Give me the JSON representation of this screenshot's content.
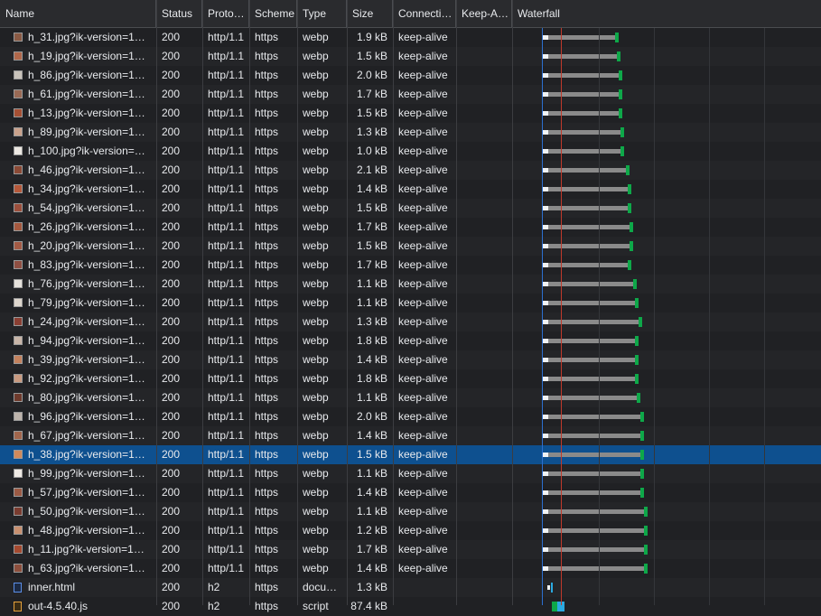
{
  "columns": [
    "Name",
    "Status",
    "Proto…",
    "Scheme",
    "Type",
    "Size",
    "Connecti…",
    "Keep-A…",
    "Waterfall"
  ],
  "rows": [
    {
      "name": "h_31.jpg?ik-version=1…",
      "status": "200",
      "proto": "http/1.1",
      "scheme": "https",
      "type": "webp",
      "size": "1.9 kB",
      "conn": "keep-alive",
      "thumb": "#8a5a44"
    },
    {
      "name": "h_19.jpg?ik-version=1…",
      "status": "200",
      "proto": "http/1.1",
      "scheme": "https",
      "type": "webp",
      "size": "1.5 kB",
      "conn": "keep-alive",
      "thumb": "#b0674a"
    },
    {
      "name": "h_86.jpg?ik-version=1…",
      "status": "200",
      "proto": "http/1.1",
      "scheme": "https",
      "type": "webp",
      "size": "2.0 kB",
      "conn": "keep-alive",
      "thumb": "#c9c3bb"
    },
    {
      "name": "h_61.jpg?ik-version=1…",
      "status": "200",
      "proto": "http/1.1",
      "scheme": "https",
      "type": "webp",
      "size": "1.7 kB",
      "conn": "keep-alive",
      "thumb": "#9a6a55"
    },
    {
      "name": "h_13.jpg?ik-version=1…",
      "status": "200",
      "proto": "http/1.1",
      "scheme": "https",
      "type": "webp",
      "size": "1.5 kB",
      "conn": "keep-alive",
      "thumb": "#a65034"
    },
    {
      "name": "h_89.jpg?ik-version=1…",
      "status": "200",
      "proto": "http/1.1",
      "scheme": "https",
      "type": "webp",
      "size": "1.3 kB",
      "conn": "keep-alive",
      "thumb": "#caa28c"
    },
    {
      "name": "h_100.jpg?ik-version=…",
      "status": "200",
      "proto": "http/1.1",
      "scheme": "https",
      "type": "webp",
      "size": "1.0 kB",
      "conn": "keep-alive",
      "thumb": "#ece8e2"
    },
    {
      "name": "h_46.jpg?ik-version=1…",
      "status": "200",
      "proto": "http/1.1",
      "scheme": "https",
      "type": "webp",
      "size": "2.1 kB",
      "conn": "keep-alive",
      "thumb": "#8b4a36"
    },
    {
      "name": "h_34.jpg?ik-version=1…",
      "status": "200",
      "proto": "http/1.1",
      "scheme": "https",
      "type": "webp",
      "size": "1.4 kB",
      "conn": "keep-alive",
      "thumb": "#b5583a"
    },
    {
      "name": "h_54.jpg?ik-version=1…",
      "status": "200",
      "proto": "http/1.1",
      "scheme": "https",
      "type": "webp",
      "size": "1.5 kB",
      "conn": "keep-alive",
      "thumb": "#9c4f3c"
    },
    {
      "name": "h_26.jpg?ik-version=1…",
      "status": "200",
      "proto": "http/1.1",
      "scheme": "https",
      "type": "webp",
      "size": "1.7 kB",
      "conn": "keep-alive",
      "thumb": "#a4583e"
    },
    {
      "name": "h_20.jpg?ik-version=1…",
      "status": "200",
      "proto": "http/1.1",
      "scheme": "https",
      "type": "webp",
      "size": "1.5 kB",
      "conn": "keep-alive",
      "thumb": "#a35a44"
    },
    {
      "name": "h_83.jpg?ik-version=1…",
      "status": "200",
      "proto": "http/1.1",
      "scheme": "https",
      "type": "webp",
      "size": "1.7 kB",
      "conn": "keep-alive",
      "thumb": "#8f4f42"
    },
    {
      "name": "h_76.jpg?ik-version=1…",
      "status": "200",
      "proto": "http/1.1",
      "scheme": "https",
      "type": "webp",
      "size": "1.1 kB",
      "conn": "keep-alive",
      "thumb": "#e6e2dc"
    },
    {
      "name": "h_79.jpg?ik-version=1…",
      "status": "200",
      "proto": "http/1.1",
      "scheme": "https",
      "type": "webp",
      "size": "1.1 kB",
      "conn": "keep-alive",
      "thumb": "#ddd6cd"
    },
    {
      "name": "h_24.jpg?ik-version=1…",
      "status": "200",
      "proto": "http/1.1",
      "scheme": "https",
      "type": "webp",
      "size": "1.3 kB",
      "conn": "keep-alive",
      "thumb": "#8a3f33"
    },
    {
      "name": "h_94.jpg?ik-version=1…",
      "status": "200",
      "proto": "http/1.1",
      "scheme": "https",
      "type": "webp",
      "size": "1.8 kB",
      "conn": "keep-alive",
      "thumb": "#c8b5a8"
    },
    {
      "name": "h_39.jpg?ik-version=1…",
      "status": "200",
      "proto": "http/1.1",
      "scheme": "https",
      "type": "webp",
      "size": "1.4 kB",
      "conn": "keep-alive",
      "thumb": "#c4825e"
    },
    {
      "name": "h_92.jpg?ik-version=1…",
      "status": "200",
      "proto": "http/1.1",
      "scheme": "https",
      "type": "webp",
      "size": "1.8 kB",
      "conn": "keep-alive",
      "thumb": "#c99a80"
    },
    {
      "name": "h_80.jpg?ik-version=1…",
      "status": "200",
      "proto": "http/1.1",
      "scheme": "https",
      "type": "webp",
      "size": "1.1 kB",
      "conn": "keep-alive",
      "thumb": "#6e3a2c"
    },
    {
      "name": "h_96.jpg?ik-version=1…",
      "status": "200",
      "proto": "http/1.1",
      "scheme": "https",
      "type": "webp",
      "size": "2.0 kB",
      "conn": "keep-alive",
      "thumb": "#bdb3ab"
    },
    {
      "name": "h_67.jpg?ik-version=1…",
      "status": "200",
      "proto": "http/1.1",
      "scheme": "https",
      "type": "webp",
      "size": "1.4 kB",
      "conn": "keep-alive",
      "thumb": "#a2664c"
    },
    {
      "name": "h_38.jpg?ik-version=1…",
      "status": "200",
      "proto": "http/1.1",
      "scheme": "https",
      "type": "webp",
      "size": "1.5 kB",
      "conn": "keep-alive",
      "thumb": "#d08a5c",
      "selected": true
    },
    {
      "name": "h_99.jpg?ik-version=1…",
      "status": "200",
      "proto": "http/1.1",
      "scheme": "https",
      "type": "webp",
      "size": "1.1 kB",
      "conn": "keep-alive",
      "thumb": "#efeae5"
    },
    {
      "name": "h_57.jpg?ik-version=1…",
      "status": "200",
      "proto": "http/1.1",
      "scheme": "https",
      "type": "webp",
      "size": "1.4 kB",
      "conn": "keep-alive",
      "thumb": "#9b5a44"
    },
    {
      "name": "h_50.jpg?ik-version=1…",
      "status": "200",
      "proto": "http/1.1",
      "scheme": "https",
      "type": "webp",
      "size": "1.1 kB",
      "conn": "keep-alive",
      "thumb": "#7a3c30"
    },
    {
      "name": "h_48.jpg?ik-version=1…",
      "status": "200",
      "proto": "http/1.1",
      "scheme": "https",
      "type": "webp",
      "size": "1.2 kB",
      "conn": "keep-alive",
      "thumb": "#c89070"
    },
    {
      "name": "h_11.jpg?ik-version=1…",
      "status": "200",
      "proto": "http/1.1",
      "scheme": "https",
      "type": "webp",
      "size": "1.7 kB",
      "conn": "keep-alive",
      "thumb": "#a54a30"
    },
    {
      "name": "h_63.jpg?ik-version=1…",
      "status": "200",
      "proto": "http/1.1",
      "scheme": "https",
      "type": "webp",
      "size": "1.4 kB",
      "conn": "keep-alive",
      "thumb": "#8c4e3c"
    },
    {
      "name": "inner.html",
      "status": "200",
      "proto": "h2",
      "scheme": "https",
      "type": "docu…",
      "size": "1.3 kB",
      "conn": "",
      "icon": "doc-icon"
    },
    {
      "name": "out-4.5.40.js",
      "status": "200",
      "proto": "h2",
      "scheme": "https",
      "type": "script",
      "size": "87.4 kB",
      "conn": "",
      "icon": "js-icon"
    }
  ],
  "colors": {
    "background": "#202124",
    "selected_row": "#0e508f",
    "waterfall_bar": "#8a8a8a",
    "waterfall_receive": "#0ea849",
    "dom_content_loaded_line": "#2c6fd0",
    "load_line": "#c0392b"
  }
}
